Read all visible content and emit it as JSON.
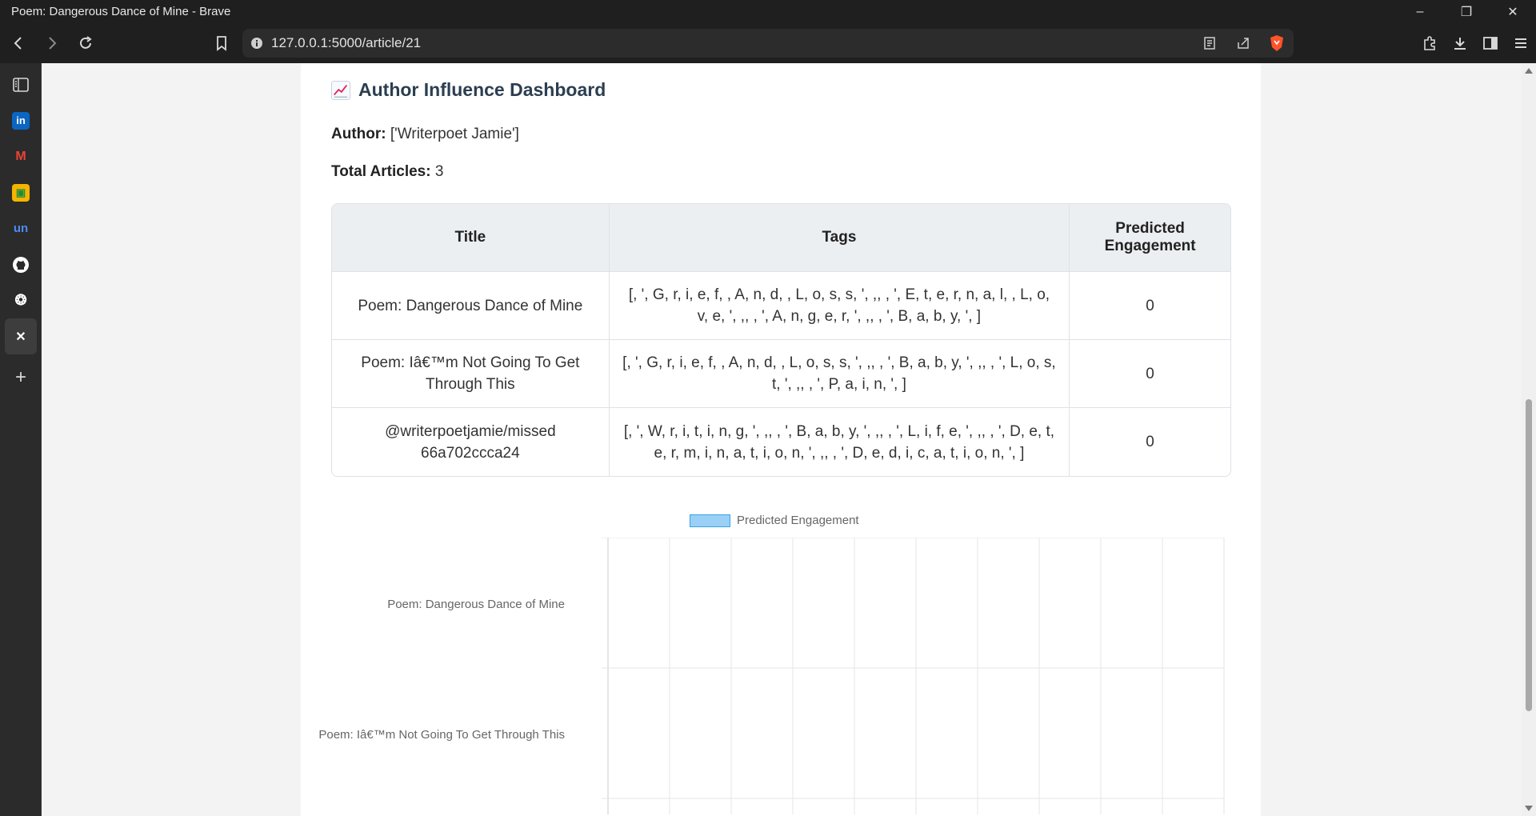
{
  "window": {
    "title": "Poem: Dangerous Dance of Mine - Brave"
  },
  "toolbar": {
    "url": "127.0.0.1:5000/article/21"
  },
  "sidebar": {
    "items": [
      {
        "name": "reading-list-icon"
      },
      {
        "name": "linkedin-icon",
        "glyph": "in",
        "color": "#0a66c2"
      },
      {
        "name": "gmail-icon",
        "glyph": "M",
        "color": "#ea4335"
      },
      {
        "name": "contacts-icon",
        "glyph": "▣",
        "color": "#f4b400"
      },
      {
        "name": "unstop-icon",
        "glyph": "un",
        "color": "#1c4980"
      },
      {
        "name": "github-icon",
        "glyph": "●",
        "color": "#ffffff"
      },
      {
        "name": "chatgpt-icon",
        "glyph": "❂",
        "color": "#ffffff"
      },
      {
        "name": "x-icon",
        "glyph": "✕",
        "color": "#ffffff"
      }
    ]
  },
  "page": {
    "heading": "Author Influence Dashboard",
    "author_label": "Author:",
    "author_value": "['Writerpoet Jamie']",
    "total_label": "Total Articles:",
    "total_value": "3",
    "table": {
      "headers": [
        "Title",
        "Tags",
        "Predicted Engagement"
      ],
      "rows": [
        {
          "title": "Poem: Dangerous Dance of Mine",
          "tags": "[, ', G, r, i, e, f, , A, n, d, , L, o, s, s, ', ,, , ', E, t, e, r, n, a, l, , L, o, v, e, ', ,, , ', A, n, g, e, r, ', ,, , ', B, a, b, y, ', ]",
          "engagement": "0"
        },
        {
          "title": "Poem: Iâ€™m Not Going To Get Through This",
          "tags": "[, ', G, r, i, e, f, , A, n, d, , L, o, s, s, ', ,, , ', B, a, b, y, ', ,, , ', L, o, s, t, ', ,, , ', P, a, i, n, ', ]",
          "engagement": "0"
        },
        {
          "title": "@writerpoetjamie/missed 66a702ccca24",
          "tags": "[, ', W, r, i, t, i, n, g, ', ,, , ', B, a, b, y, ', ,, , ', L, i, f, e, ', ,, , ', D, e, t, e, r, m, i, n, a, t, i, o, n, ', ,, , ', D, e, d, i, c, a, t, i, o, n, ', ]",
          "engagement": "0"
        }
      ]
    }
  },
  "chart_data": {
    "type": "bar",
    "orientation": "horizontal",
    "categories": [
      "Poem: Dangerous Dance of Mine",
      "Poem: Iâ€™m Not Going To Get Through This"
    ],
    "series": [
      {
        "name": "Predicted Engagement",
        "values": [
          0,
          0
        ]
      }
    ],
    "legend": "top",
    "grid": true,
    "colors": {
      "fill": "#9ad0f5",
      "border": "#36a2eb"
    }
  }
}
